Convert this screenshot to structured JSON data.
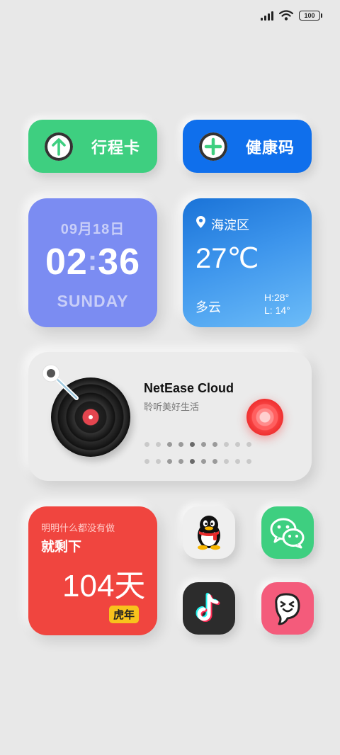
{
  "status_bar": {
    "battery": "100"
  },
  "shortcuts": {
    "trip_card_label": "行程卡",
    "health_code_label": "健康码"
  },
  "clock": {
    "date": "09月18日",
    "time_hour": "02",
    "time_minute": "36",
    "weekday": "SUNDAY"
  },
  "weather": {
    "location": "海淀区",
    "temperature": "27℃",
    "condition": "多云",
    "high": "H:28°",
    "low": "L: 14°"
  },
  "music": {
    "app_name": "NetEase Cloud",
    "slogan": "聆听美好生活"
  },
  "countdown": {
    "caption": "明明什么都没有做",
    "title": "就剩下",
    "value": "104天",
    "badge": "虎年"
  },
  "apps": [
    "QQ",
    "WeChat",
    "TikTok",
    "Soul"
  ],
  "colors": {
    "background": "#e8e8e8",
    "trip_green": "#3ecf80",
    "health_blue": "#0f6fec",
    "clock_purple": "#7b8cf2",
    "weather_blue": "#3b8ee8",
    "countdown_red": "#f0453f",
    "badge_yellow": "#f8c21c"
  }
}
